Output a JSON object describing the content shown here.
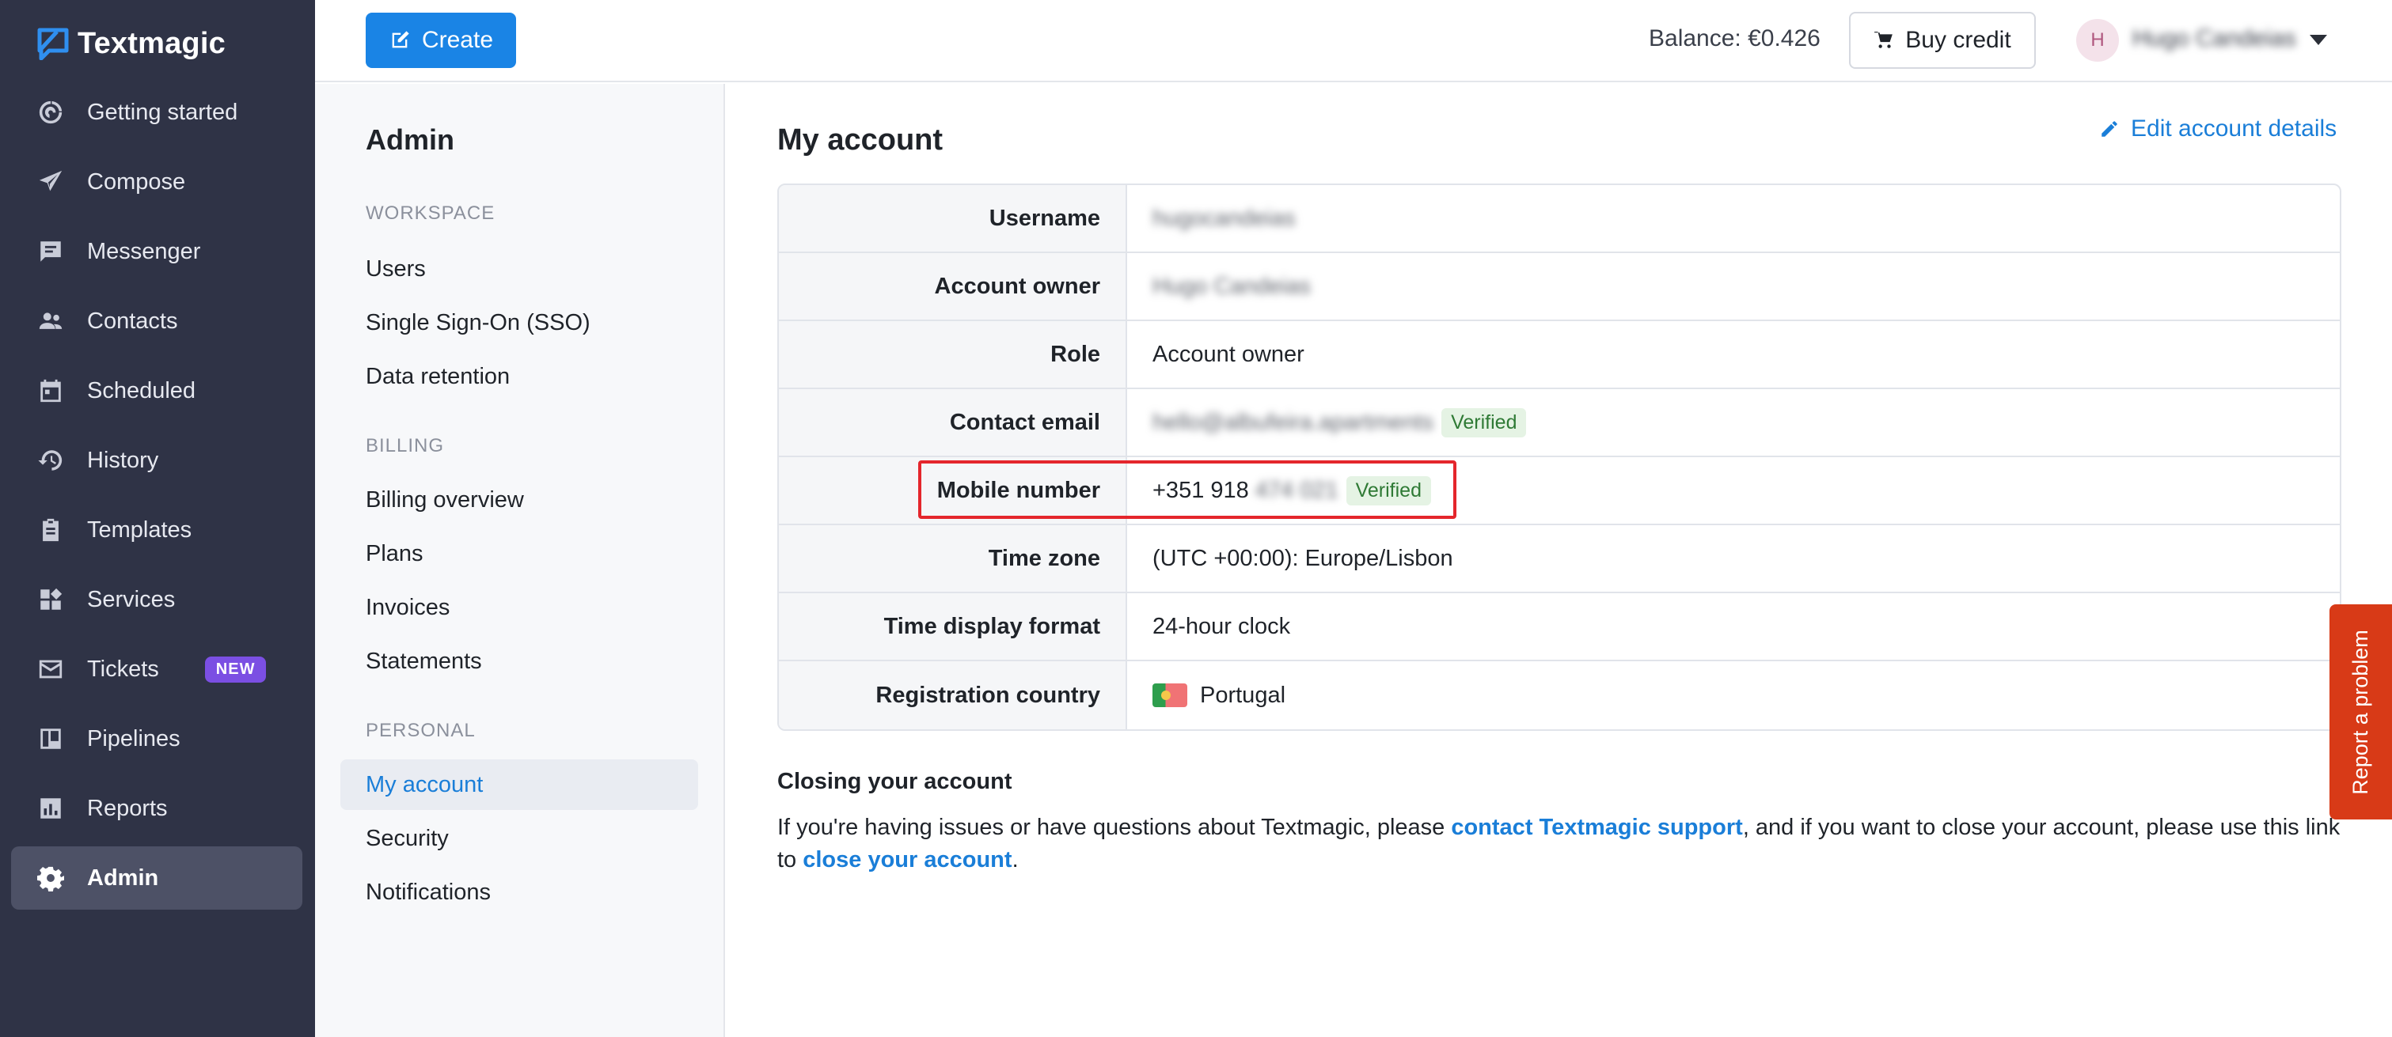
{
  "app": {
    "brand": "Textmagic"
  },
  "nav": {
    "items": [
      {
        "label": "Getting started",
        "icon": "getting-started-icon"
      },
      {
        "label": "Compose",
        "icon": "paper-plane-icon"
      },
      {
        "label": "Messenger",
        "icon": "chat-icon"
      },
      {
        "label": "Contacts",
        "icon": "contacts-icon"
      },
      {
        "label": "Scheduled",
        "icon": "calendar-icon"
      },
      {
        "label": "History",
        "icon": "history-icon"
      },
      {
        "label": "Templates",
        "icon": "clipboard-icon"
      },
      {
        "label": "Services",
        "icon": "services-icon"
      },
      {
        "label": "Tickets",
        "icon": "envelope-icon",
        "badge": "NEW"
      },
      {
        "label": "Pipelines",
        "icon": "pipelines-icon"
      },
      {
        "label": "Reports",
        "icon": "bar-chart-icon"
      },
      {
        "label": "Admin",
        "icon": "gear-icon",
        "active": true
      }
    ]
  },
  "topbar": {
    "create_label": "Create",
    "balance": "Balance: €0.426",
    "buy_credit_label": "Buy credit",
    "avatar_initial": "H",
    "user_name": "Hugo Candeias"
  },
  "submenu": {
    "title": "Admin",
    "sections": [
      {
        "heading": "WORKSPACE",
        "items": [
          "Users",
          "Single Sign-On (SSO)",
          "Data retention"
        ]
      },
      {
        "heading": "BILLING",
        "items": [
          "Billing overview",
          "Plans",
          "Invoices",
          "Statements"
        ]
      },
      {
        "heading": "PERSONAL",
        "items": [
          "My account",
          "Security",
          "Notifications"
        ]
      }
    ],
    "active_item": "My account"
  },
  "account": {
    "title": "My account",
    "edit_label": "Edit account details",
    "rows": {
      "username": {
        "label": "Username",
        "value": "hugocandeias"
      },
      "owner": {
        "label": "Account owner",
        "value": "Hugo Candeias"
      },
      "role": {
        "label": "Role",
        "value": "Account owner"
      },
      "email": {
        "label": "Contact email",
        "value": "hello@albufeira.apartments",
        "status": "Verified"
      },
      "mobile": {
        "label": "Mobile number",
        "value_visible": "+351 918",
        "value_hidden": "474 021",
        "status": "Verified"
      },
      "timezone": {
        "label": "Time zone",
        "value": "(UTC +00:00): Europe/Lisbon"
      },
      "time_format": {
        "label": "Time display format",
        "value": "24-hour clock"
      },
      "country": {
        "label": "Registration country",
        "value": "Portugal"
      }
    }
  },
  "closing": {
    "title": "Closing your account",
    "text_1": "If you're having issues or have questions about Textmagic, please ",
    "link_support": "contact Textmagic support",
    "text_2": ", and if you want to close your account, please use this link to ",
    "link_close": "close your account",
    "text_3": "."
  },
  "report": {
    "label": "Report a problem"
  },
  "colors": {
    "sidebar_bg": "#2f3346",
    "accent": "#1a84e5",
    "link": "#1a7ed8",
    "badge_new": "#7b4fe3",
    "report_tab": "#d83a17",
    "highlight": "#e4262c"
  }
}
